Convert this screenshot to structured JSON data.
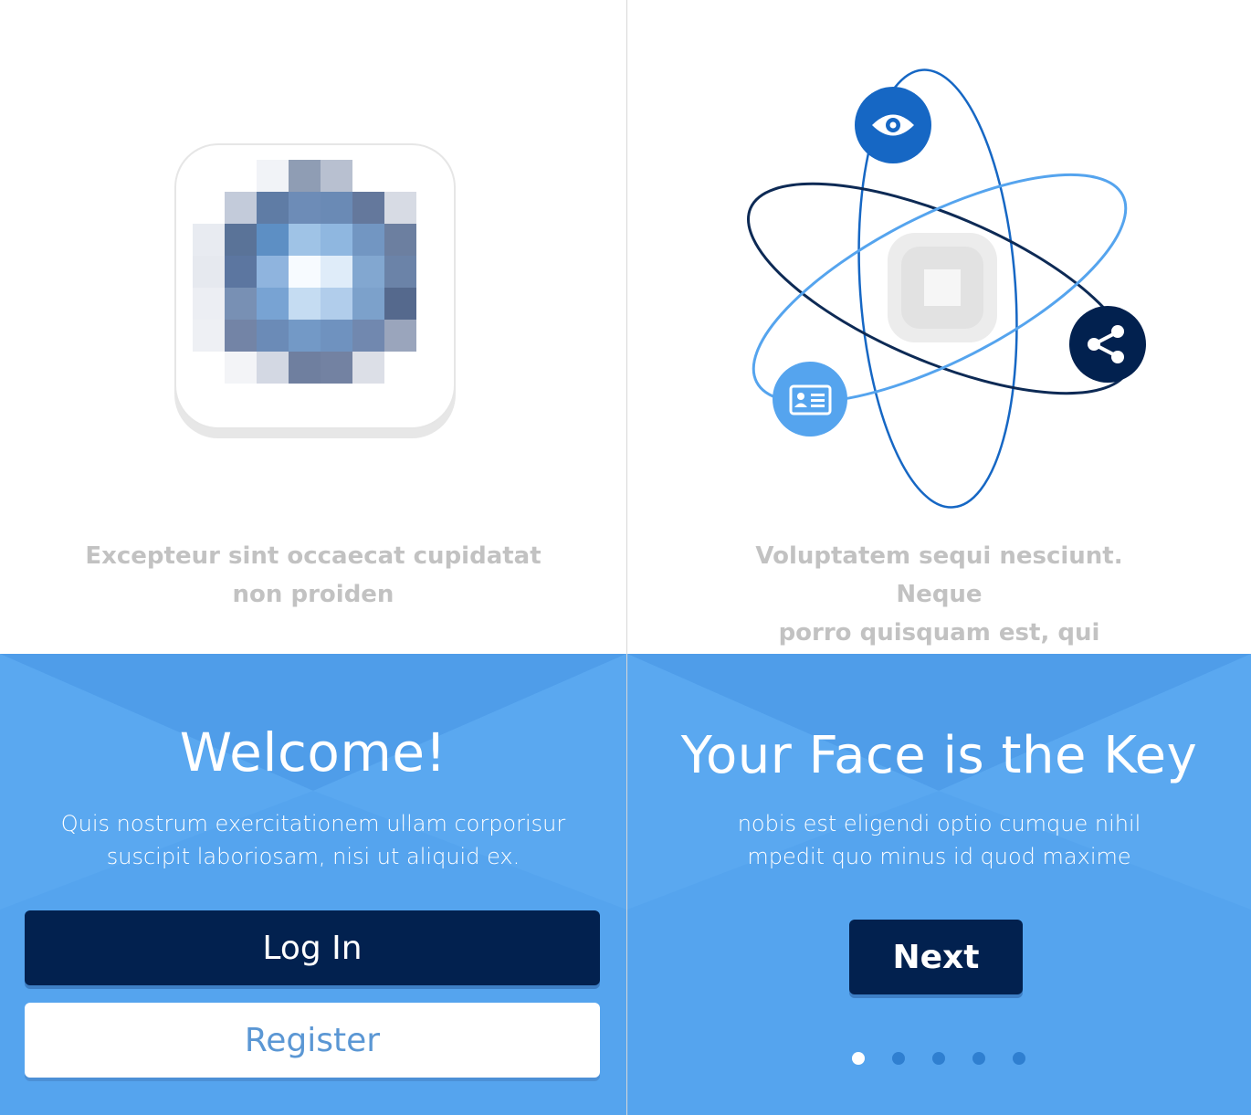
{
  "left_screen": {
    "caption_line1": "Excepteur sint occaecat cupidatat",
    "caption_line2": "non proiden",
    "title": "Welcome!",
    "subtext_line1": "Quis nostrum exercitationem ullam corporisur",
    "subtext_line2": "suscipit laboriosam, nisi ut aliquid ex.",
    "login_label": "Log In",
    "register_label": "Register"
  },
  "right_screen": {
    "caption_line1": "Voluptatem sequi nesciunt. Neque",
    "caption_line2": "porro quisquam est, qui",
    "title": "Your Face is the Key",
    "subtext_line1": "nobis est eligendi optio cumque nihil",
    "subtext_line2": "mpedit quo minus id quod maxime",
    "next_label": "Next",
    "pagination": {
      "total": 5,
      "active_index": 0
    },
    "orbit_icons": [
      "eye-icon",
      "share-icon",
      "id-card-icon"
    ]
  },
  "colors": {
    "accent_blue": "#55a4ee",
    "navy": "#02214f",
    "caption_gray": "#c2c2c2",
    "register_text": "#5b97d4"
  }
}
